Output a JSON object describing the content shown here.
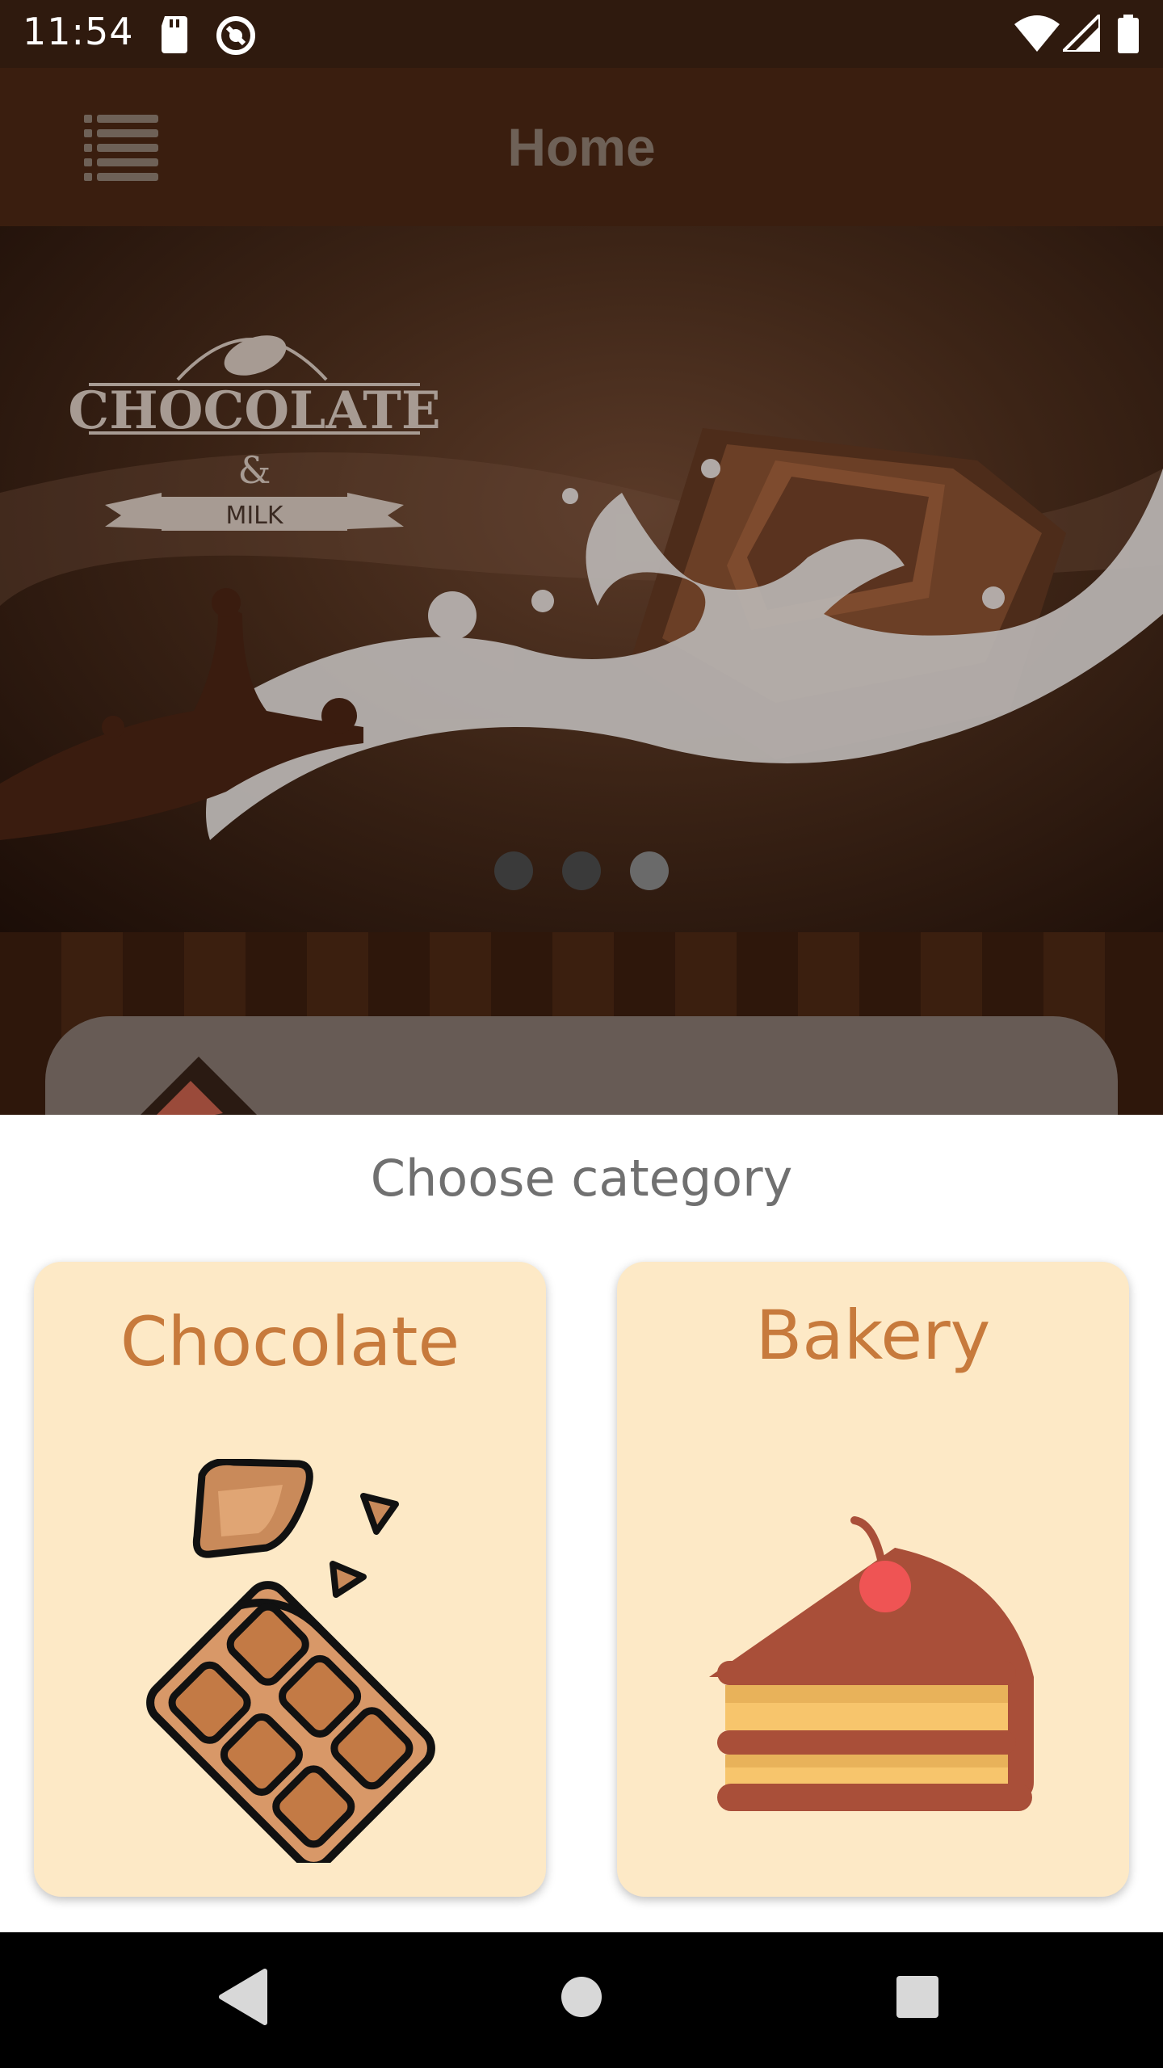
{
  "status_bar": {
    "time": "11:54",
    "icons": [
      "sd-card-icon",
      "sync-icon",
      "wifi-icon",
      "signal-icon",
      "battery-icon"
    ]
  },
  "app_bar": {
    "title": "Home",
    "menu_icon": "list-menu-icon"
  },
  "banner": {
    "logo_title": "CHOCOLATE",
    "logo_ampersand": "&",
    "logo_ribbon": "MILK",
    "slide_count": 3,
    "active_slide": 3
  },
  "sheet": {
    "title": "Choose category",
    "categories": [
      {
        "label": "Chocolate",
        "icon": "chocolate-bar-icon"
      },
      {
        "label": "Bakery",
        "icon": "cake-slice-icon"
      }
    ]
  },
  "nav_bar": {
    "buttons": [
      "back-icon",
      "home-icon",
      "recents-icon"
    ]
  },
  "colors": {
    "app_bar": "#3a1e0f",
    "card_bg": "#fde9c6",
    "card_label": "#c77a3c",
    "sheet_title": "#707070"
  }
}
